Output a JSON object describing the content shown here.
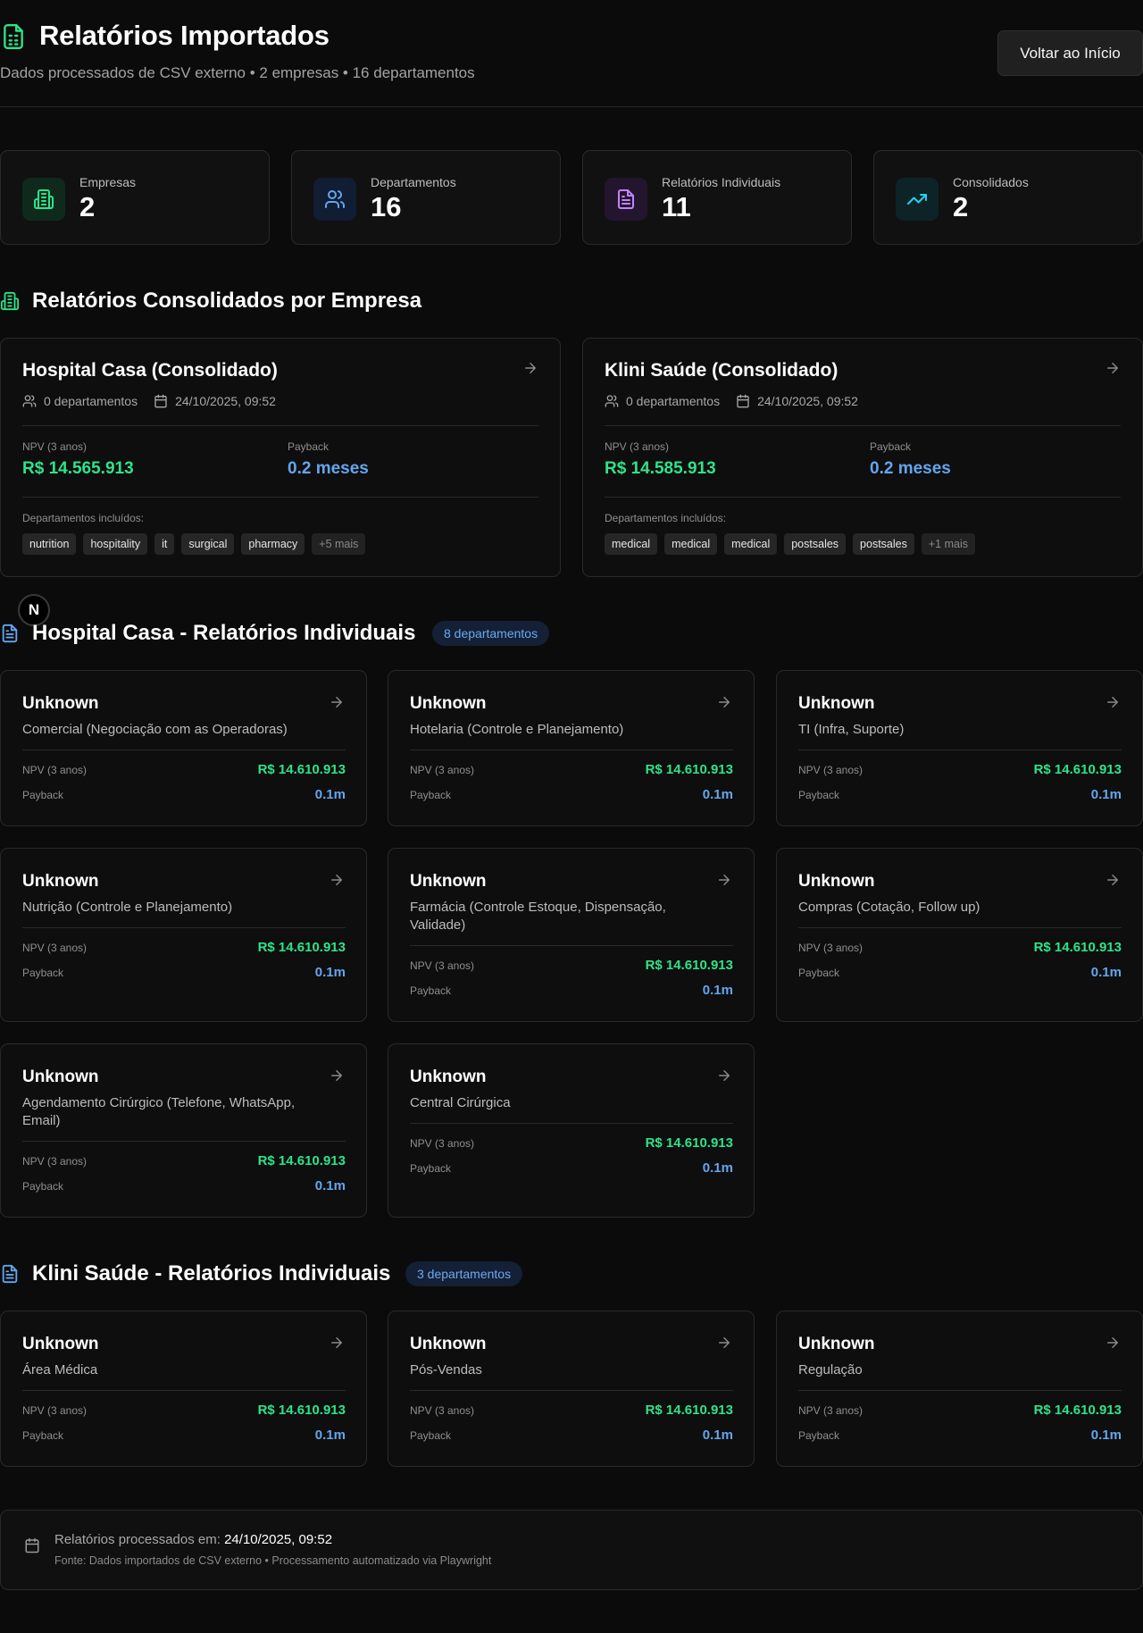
{
  "header": {
    "title": "Relatórios Importados",
    "subtitle": "Dados processados de CSV externo • 2 empresas • 16 departamentos",
    "back_button": "Voltar ao Início"
  },
  "stats": [
    {
      "label": "Empresas",
      "value": "2",
      "icon": "building-icon",
      "color": "#2ee38a"
    },
    {
      "label": "Departamentos",
      "value": "16",
      "icon": "users-icon",
      "color": "#63a6ef"
    },
    {
      "label": "Relatórios Individuais",
      "value": "11",
      "icon": "file-text-icon",
      "color": "#c084fc"
    },
    {
      "label": "Consolidados",
      "value": "2",
      "icon": "trending-up-icon",
      "color": "#22d3ee"
    }
  ],
  "consolidated": {
    "title": "Relatórios Consolidados por Empresa",
    "cards": [
      {
        "title": "Hospital Casa (Consolidado)",
        "departments": "0 departamentos",
        "date": "24/10/2025, 09:52",
        "npv_label": "NPV (3 anos)",
        "npv": "R$ 14.565.913",
        "payback_label": "Payback",
        "payback": "0.2 meses",
        "included_label": "Departamentos incluídos:",
        "tags": [
          "nutrition",
          "hospitality",
          "it",
          "surgical",
          "pharmacy"
        ],
        "more": "+5 mais"
      },
      {
        "title": "Klini Saúde (Consolidado)",
        "departments": "0 departamentos",
        "date": "24/10/2025, 09:52",
        "npv_label": "NPV (3 anos)",
        "npv": "R$ 14.585.913",
        "payback_label": "Payback",
        "payback": "0.2 meses",
        "included_label": "Departamentos incluídos:",
        "tags": [
          "medical",
          "medical",
          "medical",
          "postsales",
          "postsales"
        ],
        "more": "+1 mais"
      }
    ]
  },
  "avatar_letter": "N",
  "hospital_section": {
    "title": "Hospital Casa - Relatórios Individuais",
    "badge": "8 departamentos",
    "cards": [
      {
        "name": "Unknown",
        "dept": "Comercial (Negociação com as Operadoras)",
        "npv_label": "NPV (3 anos)",
        "npv": "R$ 14.610.913",
        "payback_label": "Payback",
        "payback": "0.1m"
      },
      {
        "name": "Unknown",
        "dept": "Hotelaria (Controle e Planejamento)",
        "npv_label": "NPV (3 anos)",
        "npv": "R$ 14.610.913",
        "payback_label": "Payback",
        "payback": "0.1m"
      },
      {
        "name": "Unknown",
        "dept": "TI (Infra, Suporte)",
        "npv_label": "NPV (3 anos)",
        "npv": "R$ 14.610.913",
        "payback_label": "Payback",
        "payback": "0.1m"
      },
      {
        "name": "Unknown",
        "dept": "Nutrição (Controle e Planejamento)",
        "npv_label": "NPV (3 anos)",
        "npv": "R$ 14.610.913",
        "payback_label": "Payback",
        "payback": "0.1m"
      },
      {
        "name": "Unknown",
        "dept": "Farmácia (Controle Estoque, Dispensação, Validade)",
        "npv_label": "NPV (3 anos)",
        "npv": "R$ 14.610.913",
        "payback_label": "Payback",
        "payback": "0.1m"
      },
      {
        "name": "Unknown",
        "dept": "Compras (Cotação, Follow up)",
        "npv_label": "NPV (3 anos)",
        "npv": "R$ 14.610.913",
        "payback_label": "Payback",
        "payback": "0.1m"
      },
      {
        "name": "Unknown",
        "dept": "Agendamento Cirúrgico (Telefone, WhatsApp, Email)",
        "npv_label": "NPV (3 anos)",
        "npv": "R$ 14.610.913",
        "payback_label": "Payback",
        "payback": "0.1m"
      },
      {
        "name": "Unknown",
        "dept": "Central Cirúrgica",
        "npv_label": "NPV (3 anos)",
        "npv": "R$ 14.610.913",
        "payback_label": "Payback",
        "payback": "0.1m"
      }
    ]
  },
  "klini_section": {
    "title": "Klini Saúde - Relatórios Individuais",
    "badge": "3 departamentos",
    "cards": [
      {
        "name": "Unknown",
        "dept": "Área Médica",
        "npv_label": "NPV (3 anos)",
        "npv": "R$ 14.610.913",
        "payback_label": "Payback",
        "payback": "0.1m"
      },
      {
        "name": "Unknown",
        "dept": "Pós-Vendas",
        "npv_label": "NPV (3 anos)",
        "npv": "R$ 14.610.913",
        "payback_label": "Payback",
        "payback": "0.1m"
      },
      {
        "name": "Unknown",
        "dept": "Regulação",
        "npv_label": "NPV (3 anos)",
        "npv": "R$ 14.610.913",
        "payback_label": "Payback",
        "payback": "0.1m"
      }
    ]
  },
  "footer": {
    "processed_label": "Relatórios processados em:",
    "processed_date": "24/10/2025, 09:52",
    "source": "Fonte: Dados importados de CSV externo • Processamento automatizado via Playwright"
  }
}
